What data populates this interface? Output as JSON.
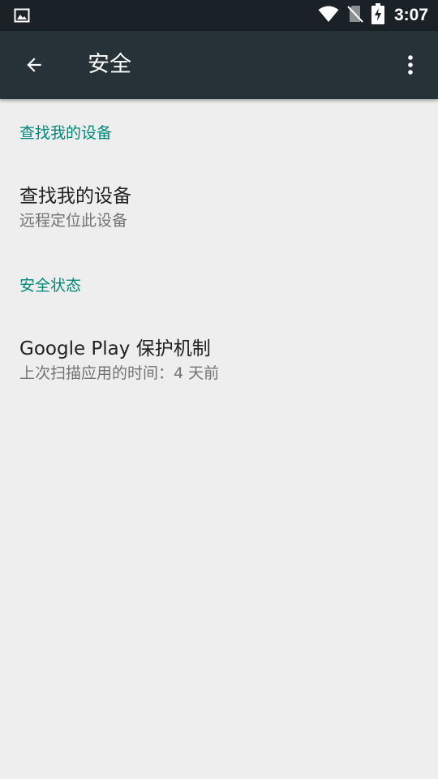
{
  "status_bar": {
    "time": "3:07",
    "icons": [
      "image-notification-icon",
      "wifi-icon",
      "no-sim-icon",
      "battery-charging-icon"
    ]
  },
  "app_bar": {
    "title": "安全",
    "back_icon": "arrow-back-icon",
    "overflow_icon": "more-vert-icon"
  },
  "sections": [
    {
      "header": "查找我的设备",
      "items": [
        {
          "title": "查找我的设备",
          "summary": "远程定位此设备"
        }
      ]
    },
    {
      "header": "安全状态",
      "items": [
        {
          "title": "Google Play 保护机制",
          "summary": "上次扫描应用的时间：4 天前"
        }
      ]
    }
  ],
  "colors": {
    "status_bar": "#1a2227",
    "app_bar": "#263238",
    "background": "#eeeeee",
    "accent": "#00897b"
  }
}
